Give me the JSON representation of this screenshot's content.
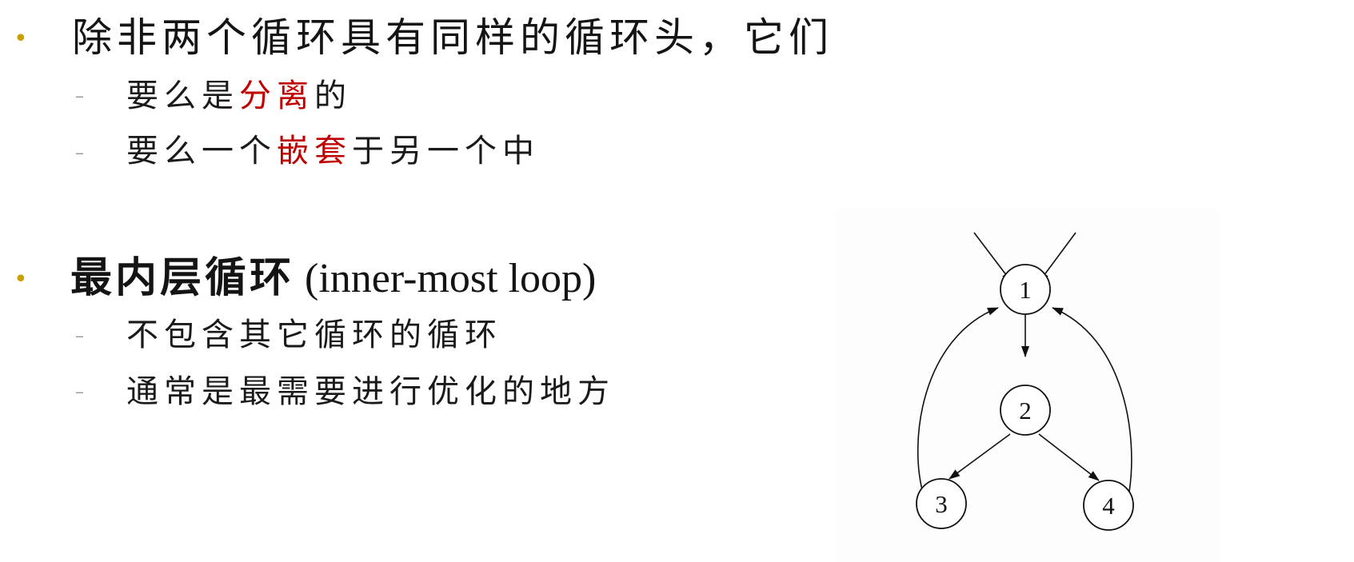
{
  "slide": {
    "bullet_char": "•",
    "dash_char": "–",
    "section1": {
      "heading": "除非两个循环具有同样的循环头，它们",
      "items": [
        {
          "before": "要么是",
          "highlight": "分离",
          "after": "的"
        },
        {
          "before": "要么一个",
          "highlight": "嵌套",
          "after": "于另一个中"
        }
      ]
    },
    "section2": {
      "heading_cjk": "最内层循环",
      "heading_latin": " (inner-most loop)",
      "items": [
        {
          "text": "不包含其它循环的循环"
        },
        {
          "text": "通常是最需要进行优化的地方"
        }
      ]
    }
  },
  "diagram": {
    "nodes": [
      {
        "id": "1",
        "label": "1"
      },
      {
        "id": "2",
        "label": "2"
      },
      {
        "id": "3",
        "label": "3"
      },
      {
        "id": "4",
        "label": "4"
      }
    ],
    "edges": [
      {
        "from": "entry-left",
        "to": "1"
      },
      {
        "from": "entry-right",
        "to": "1"
      },
      {
        "from": "1",
        "to": "2"
      },
      {
        "from": "2",
        "to": "3"
      },
      {
        "from": "2",
        "to": "4"
      },
      {
        "from": "3",
        "to": "1"
      },
      {
        "from": "4",
        "to": "1"
      }
    ],
    "colors": {
      "bullet": "#c8a000",
      "highlight": "#c00000",
      "dash": "#9a9a9a"
    }
  }
}
